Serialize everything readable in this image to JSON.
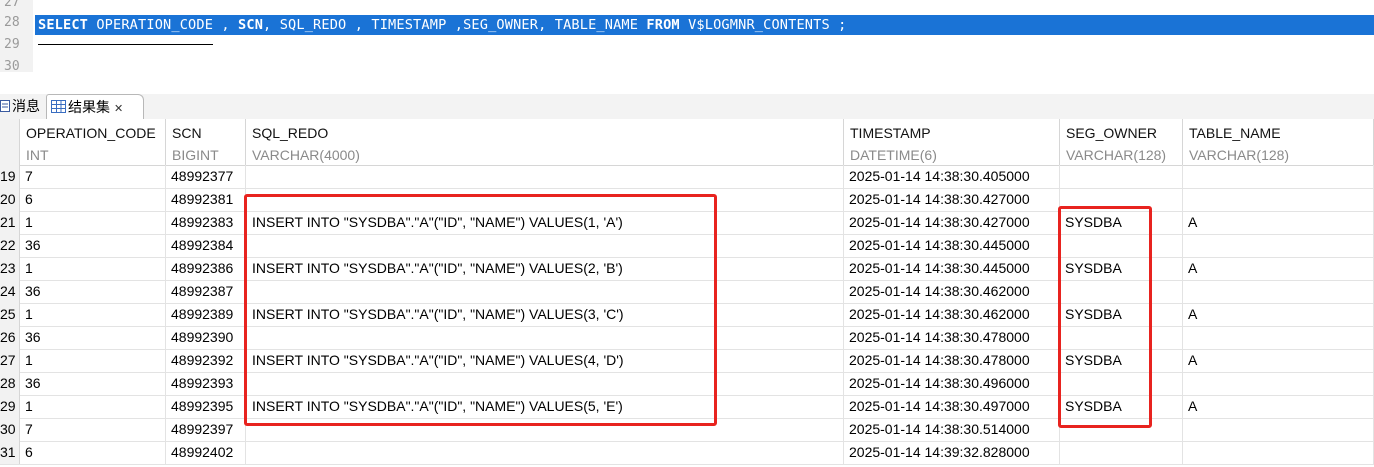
{
  "editor": {
    "lines": [
      "27",
      "28",
      "29",
      "30"
    ],
    "sql_kw_select": "SELECT",
    "sql_part1": " OPERATION_CODE , ",
    "sql_kw_scn": "SCN",
    "sql_part2": ", SQL_REDO , TIMESTAMP ,SEG_OWNER, TABLE_NAME ",
    "sql_kw_from": "FROM",
    "sql_part3": " V$LOGMNR_CONTENTS ;"
  },
  "tabs": {
    "messages": "消息",
    "result": "结果集",
    "close": "✕"
  },
  "columns": [
    {
      "name": "OPERATION_CODE",
      "type": "INT"
    },
    {
      "name": "SCN",
      "type": "BIGINT"
    },
    {
      "name": "SQL_REDO",
      "type": "VARCHAR(4000)"
    },
    {
      "name": "TIMESTAMP",
      "type": "DATETIME(6)"
    },
    {
      "name": "SEG_OWNER",
      "type": "VARCHAR(128)"
    },
    {
      "name": "TABLE_NAME",
      "type": "VARCHAR(128)"
    }
  ],
  "rows": [
    {
      "n": "19",
      "op": "7",
      "scn": "48992377",
      "redo": "",
      "ts": "2025-01-14 14:38:30.405000",
      "owner": "",
      "table": ""
    },
    {
      "n": "20",
      "op": "6",
      "scn": "48992381",
      "redo": "",
      "ts": "2025-01-14 14:38:30.427000",
      "owner": "",
      "table": ""
    },
    {
      "n": "21",
      "op": "1",
      "scn": "48992383",
      "redo": "INSERT INTO \"SYSDBA\".\"A\"(\"ID\", \"NAME\") VALUES(1, 'A')",
      "ts": "2025-01-14 14:38:30.427000",
      "owner": "SYSDBA",
      "table": "A"
    },
    {
      "n": "22",
      "op": "36",
      "scn": "48992384",
      "redo": "",
      "ts": "2025-01-14 14:38:30.445000",
      "owner": "",
      "table": ""
    },
    {
      "n": "23",
      "op": "1",
      "scn": "48992386",
      "redo": "INSERT INTO \"SYSDBA\".\"A\"(\"ID\", \"NAME\") VALUES(2, 'B')",
      "ts": "2025-01-14 14:38:30.445000",
      "owner": "SYSDBA",
      "table": "A"
    },
    {
      "n": "24",
      "op": "36",
      "scn": "48992387",
      "redo": "",
      "ts": "2025-01-14 14:38:30.462000",
      "owner": "",
      "table": ""
    },
    {
      "n": "25",
      "op": "1",
      "scn": "48992389",
      "redo": "INSERT INTO \"SYSDBA\".\"A\"(\"ID\", \"NAME\") VALUES(3, 'C')",
      "ts": "2025-01-14 14:38:30.462000",
      "owner": "SYSDBA",
      "table": "A"
    },
    {
      "n": "26",
      "op": "36",
      "scn": "48992390",
      "redo": "",
      "ts": "2025-01-14 14:38:30.478000",
      "owner": "",
      "table": ""
    },
    {
      "n": "27",
      "op": "1",
      "scn": "48992392",
      "redo": "INSERT INTO \"SYSDBA\".\"A\"(\"ID\", \"NAME\") VALUES(4, 'D')",
      "ts": "2025-01-14 14:38:30.478000",
      "owner": "SYSDBA",
      "table": "A"
    },
    {
      "n": "28",
      "op": "36",
      "scn": "48992393",
      "redo": "",
      "ts": "2025-01-14 14:38:30.496000",
      "owner": "",
      "table": ""
    },
    {
      "n": "29",
      "op": "1",
      "scn": "48992395",
      "redo": "INSERT INTO \"SYSDBA\".\"A\"(\"ID\", \"NAME\") VALUES(5, 'E')",
      "ts": "2025-01-14 14:38:30.497000",
      "owner": "SYSDBA",
      "table": "A"
    },
    {
      "n": "30",
      "op": "7",
      "scn": "48992397",
      "redo": "",
      "ts": "2025-01-14 14:38:30.514000",
      "owner": "",
      "table": ""
    },
    {
      "n": "31",
      "op": "6",
      "scn": "48992402",
      "redo": "",
      "ts": "2025-01-14 14:39:32.828000",
      "owner": "",
      "table": ""
    }
  ],
  "colors": {
    "selection": "#1a73d6",
    "highlight_box": "#e8231f"
  }
}
